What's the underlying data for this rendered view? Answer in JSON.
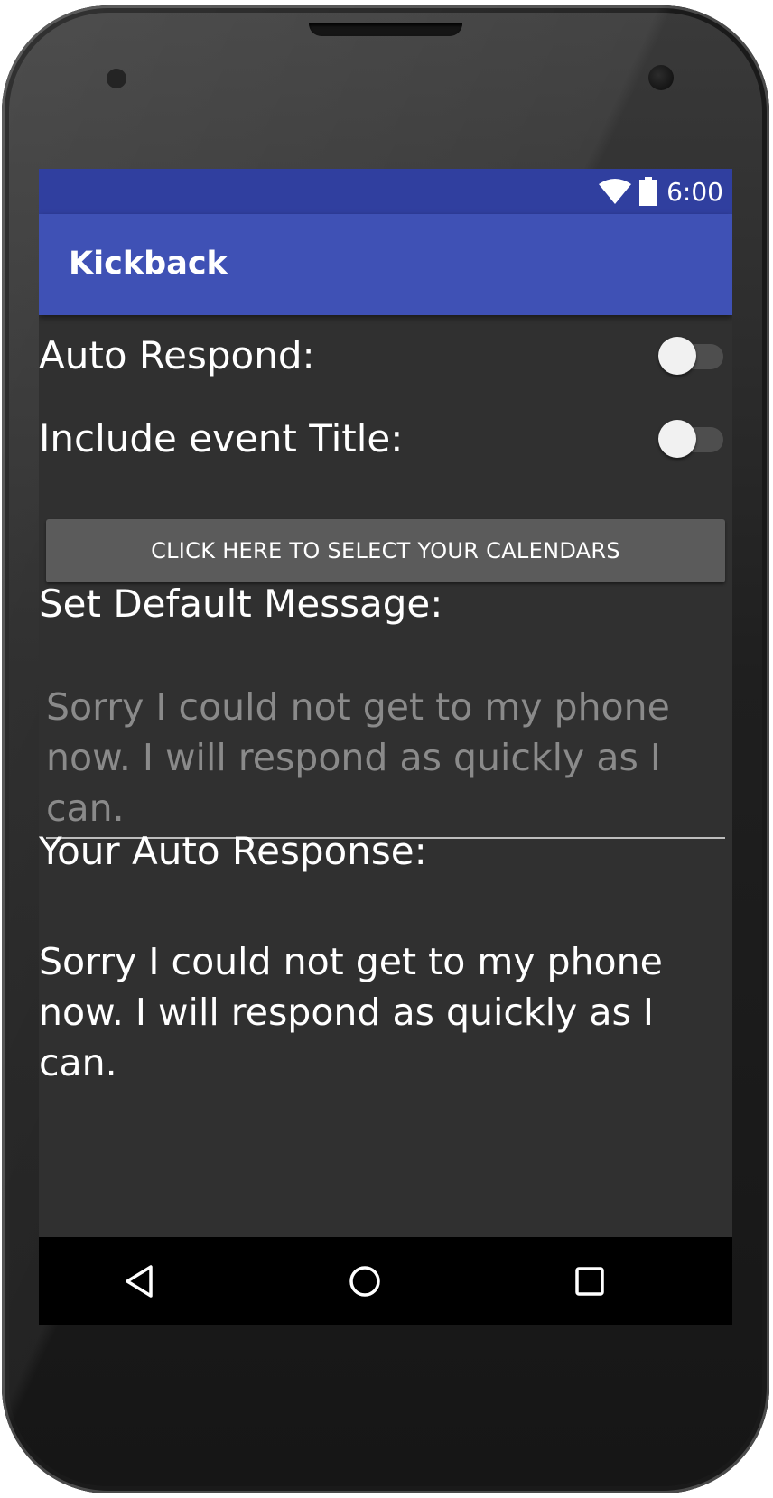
{
  "status_bar": {
    "time": "6:00",
    "icons": [
      "wifi-icon",
      "battery-icon"
    ],
    "color": "#303f9f"
  },
  "app_bar": {
    "title": "Kickback",
    "color": "#3f51b5"
  },
  "settings": {
    "auto_respond": {
      "label": "Auto Respond:",
      "on": false
    },
    "include_title": {
      "label": "Include event Title:",
      "on": false
    }
  },
  "calendar_button": {
    "label": "CLICK HERE TO SELECT YOUR CALENDARS"
  },
  "default_message": {
    "label": "Set Default Message:",
    "placeholder": "Sorry I could not get to my phone now. I will respond as quickly as I can.",
    "value": ""
  },
  "auto_response": {
    "label": "Your Auto Response:",
    "text": "Sorry I could not get to my phone now. I will respond as quickly as I can."
  },
  "nav_bar": {
    "icons": [
      "back-icon",
      "home-icon",
      "recents-icon"
    ]
  },
  "colors": {
    "background": "#303030",
    "button": "#5b5b5b",
    "placeholder_text": "#8a8a8a"
  }
}
